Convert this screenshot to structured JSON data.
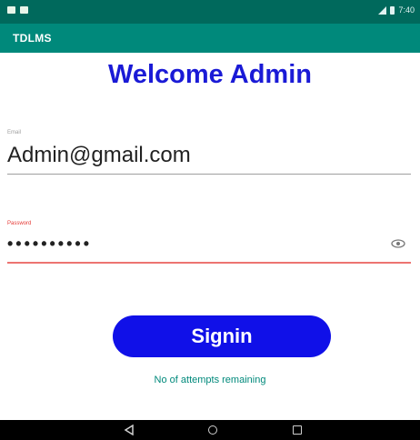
{
  "status_bar": {
    "time": "7:40"
  },
  "app_bar": {
    "title": "TDLMS"
  },
  "welcome_heading": "Welcome Admin",
  "email": {
    "label": "Email",
    "value": "Admin@gmail.com"
  },
  "password": {
    "label": "Password",
    "masked_value": "••••••••••",
    "toggle_icon": "eye-icon"
  },
  "signin_button_label": "Signin",
  "attempts_text": "No of attempts remaining",
  "colors": {
    "status_bar": "#00695c",
    "app_bar": "#00897b",
    "heading": "#1a1ad6",
    "button": "#1010e8",
    "password_underline": "#e53935",
    "attempts_text": "#00897b"
  },
  "nav_bar": {
    "icons": [
      "back-icon",
      "home-icon",
      "recents-icon"
    ]
  }
}
